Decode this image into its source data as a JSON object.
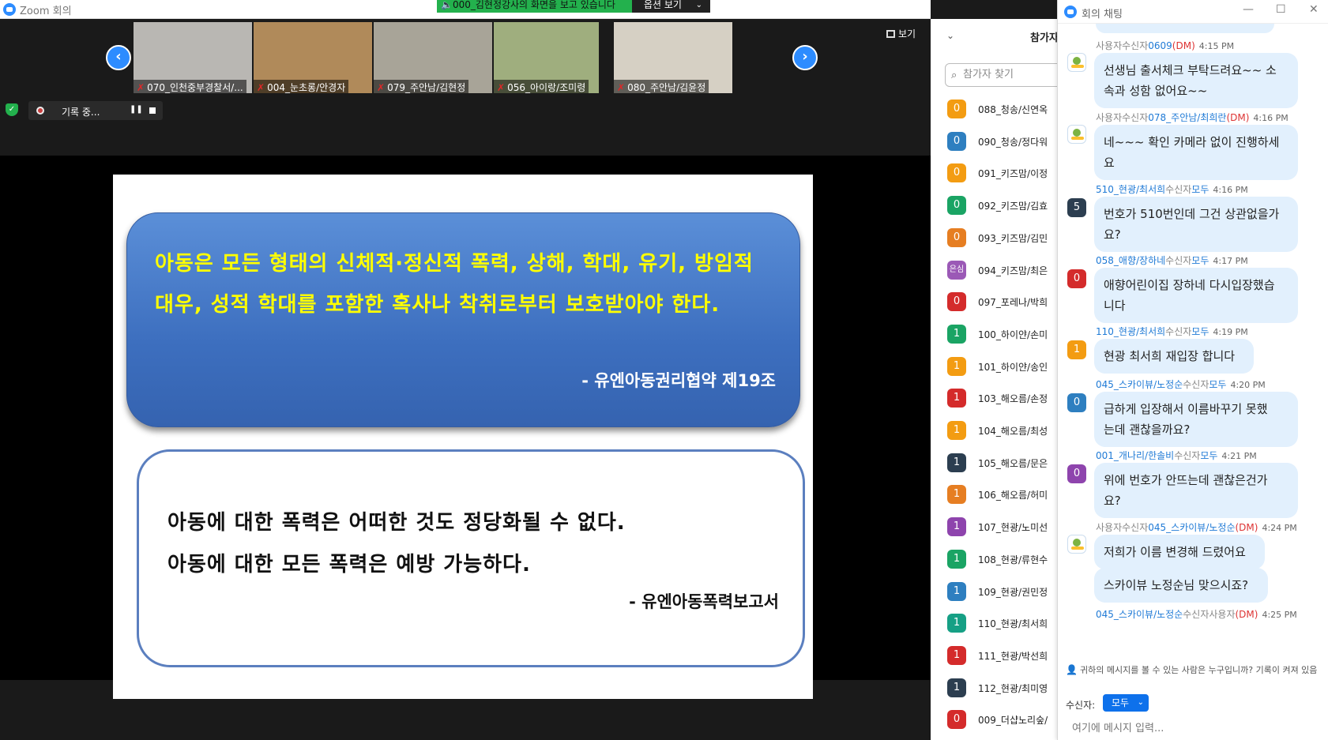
{
  "window": {
    "title": "Zoom 회의"
  },
  "share": {
    "banner": "000_김현정강사의 화면을 보고 있습니다",
    "options_label": "옵션 보기"
  },
  "gallery": {
    "view_label": "보기",
    "tiles": [
      {
        "name": "070_인천중부경찰서/...",
        "bg": "#b9b7b3"
      },
      {
        "name": "004_눈초롱/안경자",
        "bg": "#b08a5a"
      },
      {
        "name": "079_주안남/김현정",
        "bg": "#a8a498"
      },
      {
        "name": "056_아이랑/조미령",
        "bg": "#9fae7e"
      },
      {
        "name": "080_주안남/김윤정",
        "bg": "#d6d0c4"
      }
    ]
  },
  "recording": {
    "label": "기록 중..."
  },
  "slide": {
    "quote1": "아동은 모든 형태의 신체적·정신적 폭력, 상해, 학대, 유기, 방임적 대우, 성적 학대를 포함한 혹사나 착취로부터 보호받아야 한다.",
    "source1": "- 유엔아동권리협약 제19조",
    "quote2_line1": "아동에 대한 폭력은 어떠한 것도 정당화될 수 없다.",
    "quote2_line2": "아동에 대한 모든 폭력은 예방 가능하다.",
    "source2": "- 유엔아동폭력보고서"
  },
  "participants": {
    "title": "참가자",
    "search_placeholder": "참가자 찾기",
    "list": [
      {
        "badge": "0",
        "color": "#f39c12",
        "name": "088_청송/신연옥"
      },
      {
        "badge": "0",
        "color": "#2e7fc0",
        "name": "090_청송/정다워"
      },
      {
        "badge": "0",
        "color": "#f39c12",
        "name": "091_키즈맘/이정"
      },
      {
        "badge": "0",
        "color": "#1aa464",
        "name": "092_키즈맘/김효"
      },
      {
        "badge": "0",
        "color": "#e67e22",
        "name": "093_키즈맘/김민"
      },
      {
        "badge": "은심",
        "color": "#9b59b6",
        "name": "094_키즈맘/최은"
      },
      {
        "badge": "0",
        "color": "#d42b2b",
        "name": "097_포레나/박희"
      },
      {
        "badge": "1",
        "color": "#1aa464",
        "name": "100_하이얀/손미"
      },
      {
        "badge": "1",
        "color": "#f39c12",
        "name": "101_하이얀/송인"
      },
      {
        "badge": "1",
        "color": "#d42b2b",
        "name": "103_해오름/손정"
      },
      {
        "badge": "1",
        "color": "#f39c12",
        "name": "104_해오름/최성"
      },
      {
        "badge": "1",
        "color": "#2c3e50",
        "name": "105_해오름/문은"
      },
      {
        "badge": "1",
        "color": "#e67e22",
        "name": "106_해오름/허미"
      },
      {
        "badge": "1",
        "color": "#8e44ad",
        "name": "107_현광/노미선"
      },
      {
        "badge": "1",
        "color": "#1aa464",
        "name": "108_현광/류현수"
      },
      {
        "badge": "1",
        "color": "#2e7fc0",
        "name": "109_현광/권민정"
      },
      {
        "badge": "1",
        "color": "#16a085",
        "name": "110_현광/최서희"
      },
      {
        "badge": "1",
        "color": "#d42b2b",
        "name": "111_현광/박선희"
      },
      {
        "badge": "1",
        "color": "#2c3e50",
        "name": "112_현광/최미영"
      },
      {
        "badge": "0",
        "color": "#d42b2b",
        "name": "009_더샵노리숲/"
      }
    ]
  },
  "chat": {
    "title": "회의 채팅",
    "messages": [
      {
        "sender": "사용자",
        "to_word": "수신자",
        "recipient": "0609",
        "dm": "(DM)",
        "time": "4:15 PM",
        "avatar": "",
        "avatar_color": "",
        "text": [
          "선생님 출서체크 부탁드려요~~ 소",
          "속과 성함 없어요~~"
        ]
      },
      {
        "sender": "사용자",
        "to_word": "수신자",
        "recipient": "078_주안남/최희란",
        "dm": "(DM)",
        "time": "4:16 PM",
        "avatar": "",
        "avatar_color": "",
        "text": [
          "네~~~ 확인 카메라 없이 진행하세",
          "요"
        ]
      },
      {
        "sender": "510_현광/최서희",
        "to_word": "수신자",
        "recipient": "모두",
        "dm": "",
        "time": "4:16 PM",
        "avatar": "5",
        "avatar_color": "#2c3e50",
        "text": [
          "번호가 510번인데 그건 상관없을가",
          "요?"
        ]
      },
      {
        "sender": "058_애향/장하네",
        "to_word": "수신자",
        "recipient": "모두",
        "dm": "",
        "time": "4:17 PM",
        "avatar": "0",
        "avatar_color": "#d42b2b",
        "text": [
          "애향어린이집 장하네 다시입장했습",
          "니다"
        ]
      },
      {
        "sender": "110_현광/최서희",
        "to_word": "수신자",
        "recipient": "모두",
        "dm": "",
        "time": "4:19 PM",
        "avatar": "1",
        "avatar_color": "#f39c12",
        "text": [
          "현광 최서희 재입장 합니다"
        ]
      },
      {
        "sender": "045_스카이뷰/노정순",
        "to_word": "수신자",
        "recipient": "모두",
        "dm": "",
        "time": "4:20 PM",
        "avatar": "0",
        "avatar_color": "#2e7fc0",
        "text": [
          "급하게 입장해서 이름바꾸기 못했",
          "는데 괜찮을까요?"
        ]
      },
      {
        "sender": "001_개나리/한솔비",
        "to_word": "수신자",
        "recipient": "모두",
        "dm": "",
        "time": "4:21 PM",
        "avatar": "0",
        "avatar_color": "#8e44ad",
        "text": [
          "위에 번호가 안뜨는데 괜찮은건가",
          "요?"
        ]
      },
      {
        "sender": "사용자",
        "to_word": "수신자",
        "recipient": "045_스카이뷰/노정순",
        "dm": "(DM)",
        "time": "4:24 PM",
        "avatar": "",
        "avatar_color": "",
        "text": [
          "저희가 이름 변경해 드렸어요"
        ]
      },
      {
        "sender": "",
        "to_word": "",
        "recipient": "",
        "dm": "",
        "time": "",
        "avatar": "",
        "avatar_color": "",
        "text": [
          "스카이뷰 노정순님 맞으시죠?"
        ]
      },
      {
        "sender": "045_스카이뷰/노정순",
        "to_word": "수신자",
        "recipient": "사용자",
        "dm": "(DM)",
        "time": "4:25 PM",
        "avatar": "",
        "avatar_color": "",
        "text": []
      }
    ],
    "notice": "귀하의 메시지를 볼 수 있는 사람은 누구입니까? 기록이 켜져 있음",
    "recipient_label": "수신자:",
    "recipient_value": "모두",
    "input_placeholder": "여기에 메시지 입력..."
  }
}
